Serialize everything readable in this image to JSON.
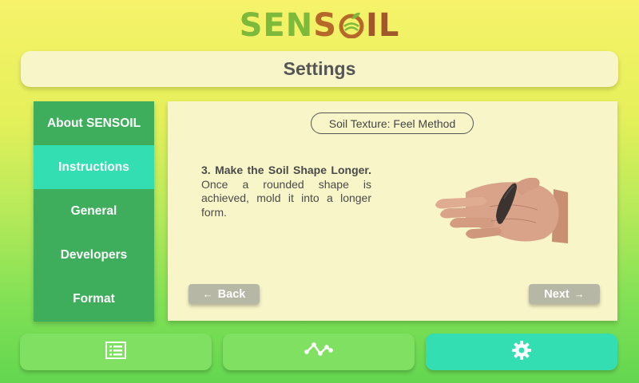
{
  "logo": {
    "part1": "SEN",
    "part2": "S",
    "part3": "IL",
    "brand_green": "#7db93a",
    "brand_brown": "#a0582a"
  },
  "header": {
    "title": "Settings"
  },
  "sidebar": {
    "items": [
      {
        "label": "About SENSOIL",
        "active": false
      },
      {
        "label": "Instructions",
        "active": true
      },
      {
        "label": "General",
        "active": false
      },
      {
        "label": "Developers",
        "active": false
      },
      {
        "label": "Format",
        "active": false
      }
    ],
    "bg_color": "#3fae5c",
    "active_color": "#33dfb2"
  },
  "panel": {
    "section_title": "Soil Texture: Feel Method",
    "step_heading": "3. Make the Soil Shape Longer.",
    "step_body": "Once a rounded shape is achieved, mold it into a longer form.",
    "image_subject": "hand-holding-soil-roll",
    "back_label": "Back",
    "next_label": "Next",
    "back_icon": "arrow-left-icon",
    "next_icon": "arrow-right-icon"
  },
  "bottom_nav": {
    "items": [
      {
        "icon": "list-icon",
        "active": false
      },
      {
        "icon": "graph-icon",
        "active": false
      },
      {
        "icon": "gear-icon",
        "active": true
      }
    ]
  }
}
